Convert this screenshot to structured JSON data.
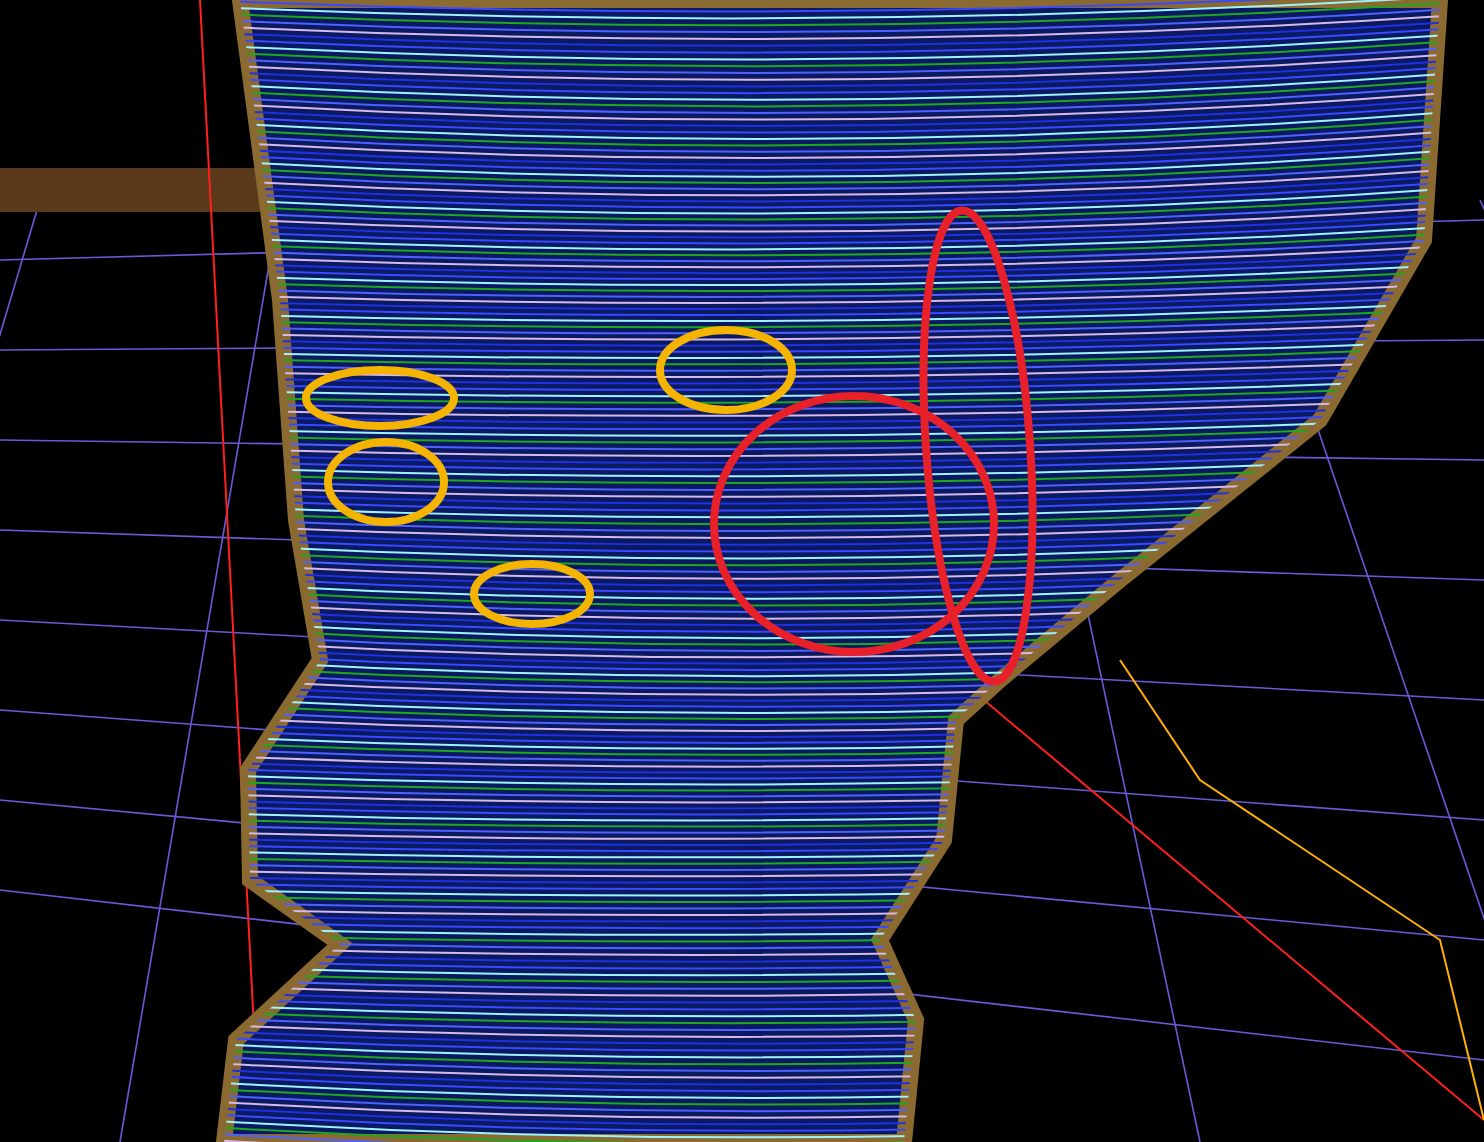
{
  "viewport": {
    "annotations": [
      {
        "kind": "ellipse",
        "color": "#f5b400"
      },
      {
        "kind": "ellipse",
        "color": "#f5b400"
      },
      {
        "kind": "ellipse",
        "color": "#f5b400"
      },
      {
        "kind": "ellipse",
        "color": "#f5b400"
      },
      {
        "kind": "ellipse",
        "color": "#e8202a"
      },
      {
        "kind": "ellipse",
        "color": "#e8202a"
      }
    ]
  }
}
